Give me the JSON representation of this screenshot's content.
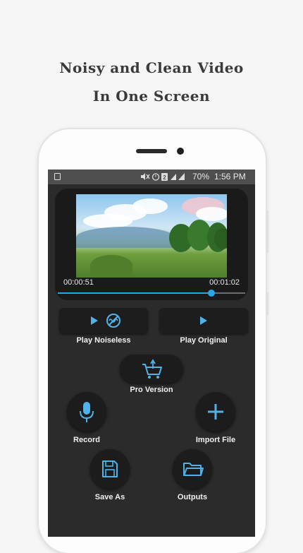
{
  "headline": {
    "line1": "Noisy and Clean Video",
    "line2": "In One Screen"
  },
  "status_bar": {
    "icons": "mute, alarm, SIM 2, signal, battery",
    "battery": "70%",
    "time": "1:56 PM"
  },
  "player": {
    "current_time": "00:00:51",
    "total_time": "00:01:02",
    "progress": 0.82
  },
  "buttons": {
    "play_noiseless": "Play Noiseless",
    "play_original": "Play Original",
    "pro_version": "Pro Version",
    "record": "Record",
    "import_file": "Import File",
    "save_as": "Save As",
    "outputs": "Outputs"
  },
  "colors": {
    "accent": "#26a7e8",
    "icon": "#4fb3ea",
    "screen_bg": "#2b2b2b"
  },
  "icons": [
    "play-icon",
    "noiseless-icon",
    "pro-cart-icon",
    "microphone-icon",
    "plus-icon",
    "save-icon",
    "folder-icon"
  ]
}
